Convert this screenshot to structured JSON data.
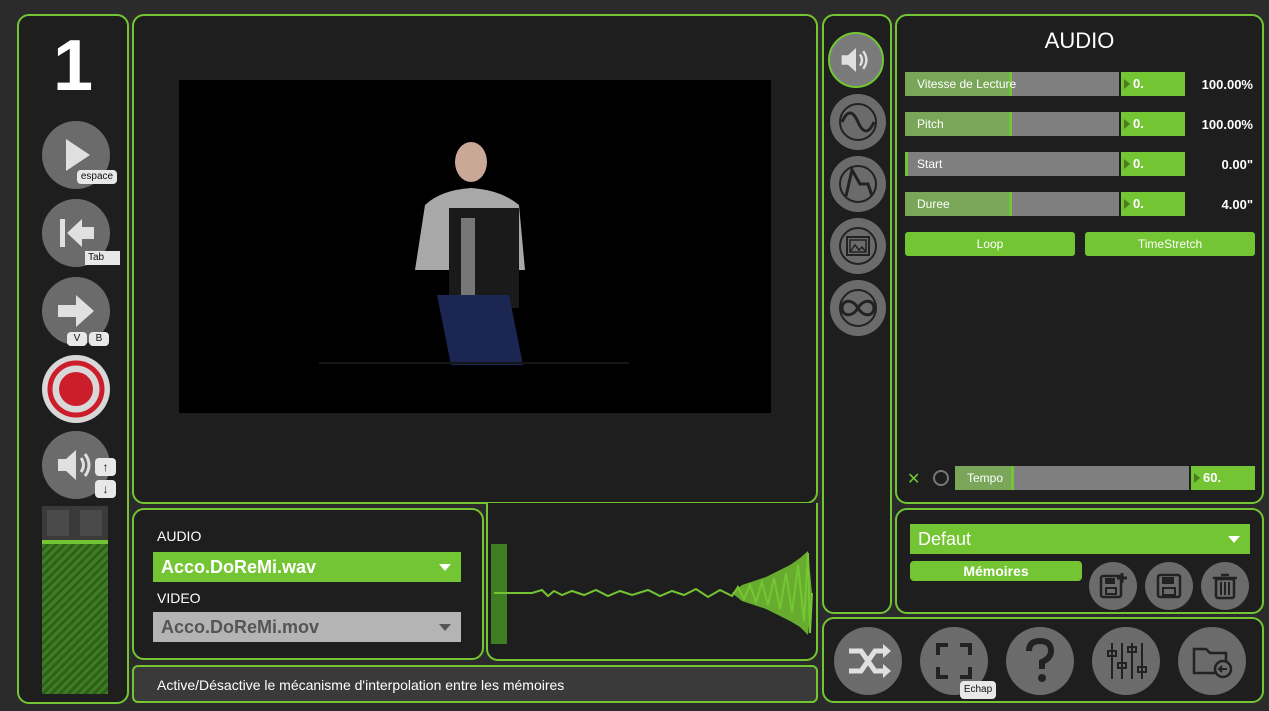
{
  "left": {
    "scene_number": "1",
    "play_key": "espace",
    "back_key": "Tab",
    "next_keys": [
      "V",
      "B"
    ],
    "volume_keys": [
      "↑",
      "↓"
    ]
  },
  "sources": {
    "audio_label": "AUDIO",
    "audio_file": "Acco.DoReMi.wav",
    "video_label": "VIDEO",
    "video_file": "Acco.DoReMi.mov"
  },
  "status": {
    "message": "Active/Désactive le mécanisme d'interpolation entre les mémoires"
  },
  "audio_panel": {
    "title": "AUDIO",
    "params": [
      {
        "label": "Vitesse de Lecture",
        "input": "0.",
        "value": "100.00%",
        "level": 0.49
      },
      {
        "label": "Pitch",
        "input": "0.",
        "value": "100.00%",
        "level": 0.49
      },
      {
        "label": "Start",
        "input": "0.",
        "value": "0.00\"",
        "level": 0.0
      },
      {
        "label": "Duree",
        "input": "0.",
        "value": "4.00\"",
        "level": 0.49
      }
    ],
    "loop_label": "Loop",
    "timestretch_label": "TimeStretch",
    "tempo_close": "✕",
    "tempo_label": "Tempo",
    "tempo_value": "60.",
    "tempo_level": 0.24
  },
  "memories": {
    "preset": "Defaut",
    "memories_label": "Mémoires"
  },
  "toolbar": {
    "escape_key": "Echap"
  },
  "colors": {
    "accent": "#74c533",
    "panel": "#1e1e1e",
    "button_gray": "#6b6b6b",
    "record_red": "#cc1e2a"
  }
}
